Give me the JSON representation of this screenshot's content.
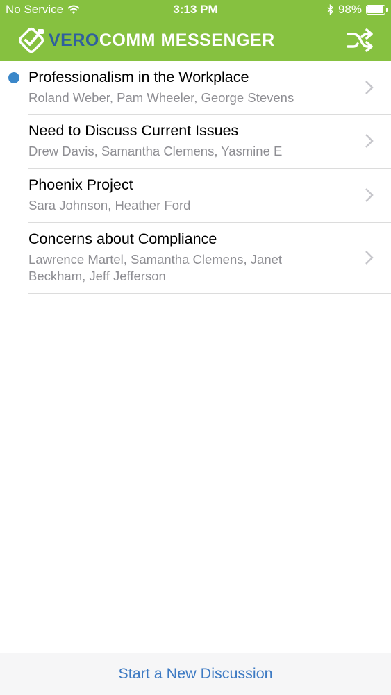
{
  "status_bar": {
    "carrier": "No Service",
    "time": "3:13 PM",
    "battery_percent": "98%",
    "battery_level": 0.98,
    "wifi_icon": "wifi-icon",
    "bluetooth_icon": "bluetooth-icon"
  },
  "header": {
    "logo_vero": "VERO",
    "logo_rest": "COMM MESSENGER",
    "shuffle_icon": "shuffle-icon",
    "color": "#86c140",
    "logo_accent": "#2f5f9e"
  },
  "discussions": [
    {
      "title": "Professionalism in the Workplace",
      "participants": "Roland Weber, Pam Wheeler, George Stevens",
      "unread": true
    },
    {
      "title": "Need to Discuss Current Issues",
      "participants": "Drew Davis, Samantha Clemens, Yasmine E",
      "unread": false
    },
    {
      "title": "Phoenix Project",
      "participants": "Sara Johnson, Heather Ford",
      "unread": false
    },
    {
      "title": "Concerns about Compliance",
      "participants": "Lawrence Martel, Samantha Clemens, Janet Beckham, Jeff Jefferson",
      "unread": false
    }
  ],
  "unread_dot_color": "#3a87c9",
  "footer": {
    "start_discussion_label": "Start a New Discussion",
    "link_color": "#3d7ac3"
  }
}
